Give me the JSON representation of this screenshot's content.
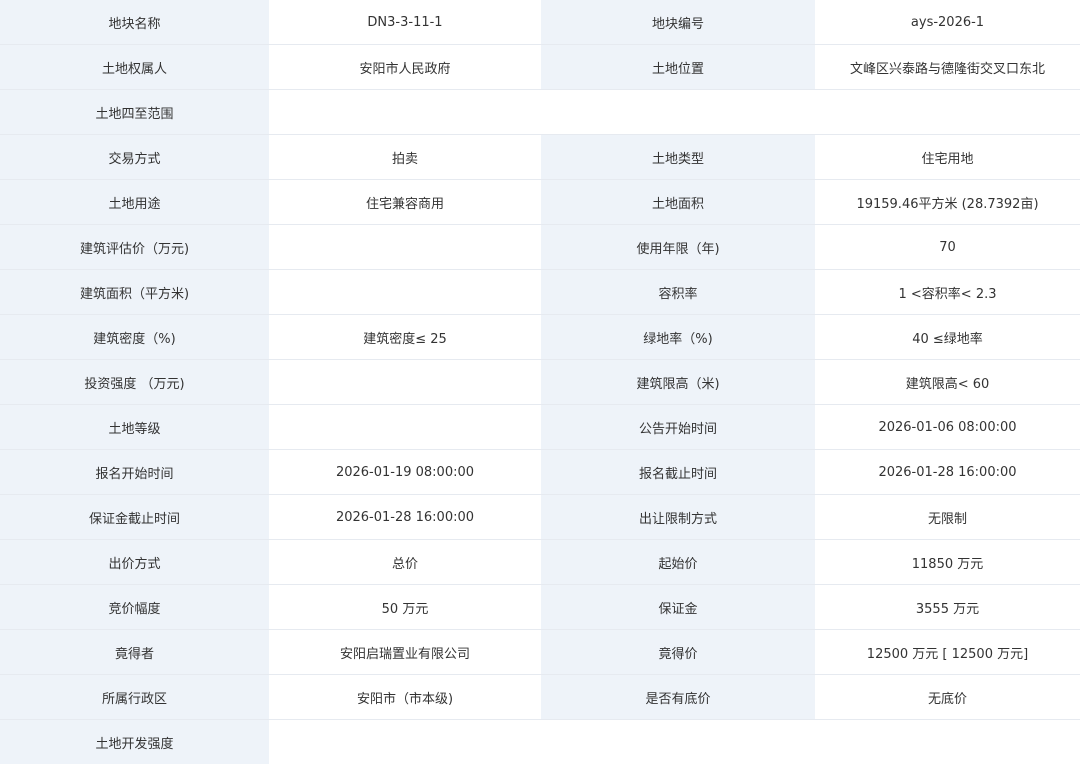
{
  "rows": [
    [
      {
        "label": "地块名称",
        "value": "DN3-3-11-1"
      },
      {
        "label": "地块编号",
        "value": "ays-2026-1"
      }
    ],
    [
      {
        "label": "土地权属人",
        "value": "安阳市人民政府"
      },
      {
        "label": "土地位置",
        "value": "文峰区兴泰路与德隆街交叉口东北"
      }
    ],
    [
      {
        "label": "土地四至范围",
        "value": ""
      }
    ],
    [
      {
        "label": "交易方式",
        "value": "拍卖"
      },
      {
        "label": "土地类型",
        "value": "住宅用地"
      }
    ],
    [
      {
        "label": "土地用途",
        "value": "住宅兼容商用"
      },
      {
        "label": "土地面积",
        "value": "19159.46平方米 (28.7392亩)"
      }
    ],
    [
      {
        "label": "建筑评估价（万元)",
        "value": ""
      },
      {
        "label": "使用年限（年)",
        "value": "70"
      }
    ],
    [
      {
        "label": "建筑面积（平方米)",
        "value": ""
      },
      {
        "label": "容积率",
        "value": "1 <容积率< 2.3"
      }
    ],
    [
      {
        "label": "建筑密度（%)",
        "value": "建筑密度≤ 25"
      },
      {
        "label": "绿地率（%)",
        "value": "40 ≤绿地率"
      }
    ],
    [
      {
        "label": "投资强度 （万元)",
        "value": ""
      },
      {
        "label": "建筑限高（米)",
        "value": "建筑限高< 60"
      }
    ],
    [
      {
        "label": "土地等级",
        "value": ""
      },
      {
        "label": "公告开始时间",
        "value": "2026-01-06 08:00:00"
      }
    ],
    [
      {
        "label": "报名开始时间",
        "value": "2026-01-19 08:00:00"
      },
      {
        "label": "报名截止时间",
        "value": "2026-01-28 16:00:00"
      }
    ],
    [
      {
        "label": "保证金截止时间",
        "value": "2026-01-28 16:00:00"
      },
      {
        "label": "出让限制方式",
        "value": "无限制"
      }
    ],
    [
      {
        "label": "出价方式",
        "value": "总价"
      },
      {
        "label": "起始价",
        "value": "11850 万元"
      }
    ],
    [
      {
        "label": "竞价幅度",
        "value": "50 万元"
      },
      {
        "label": "保证金",
        "value": "3555 万元"
      }
    ],
    [
      {
        "label": "竟得者",
        "value": "安阳启瑞置业有限公司"
      },
      {
        "label": "竟得价",
        "value": "12500 万元 [ 12500 万元]"
      }
    ],
    [
      {
        "label": "所属行政区",
        "value": "安阳市（市本级)"
      },
      {
        "label": "是否有底价",
        "value": "无底价"
      }
    ],
    [
      {
        "label": "土地开发强度",
        "value": ""
      }
    ]
  ]
}
